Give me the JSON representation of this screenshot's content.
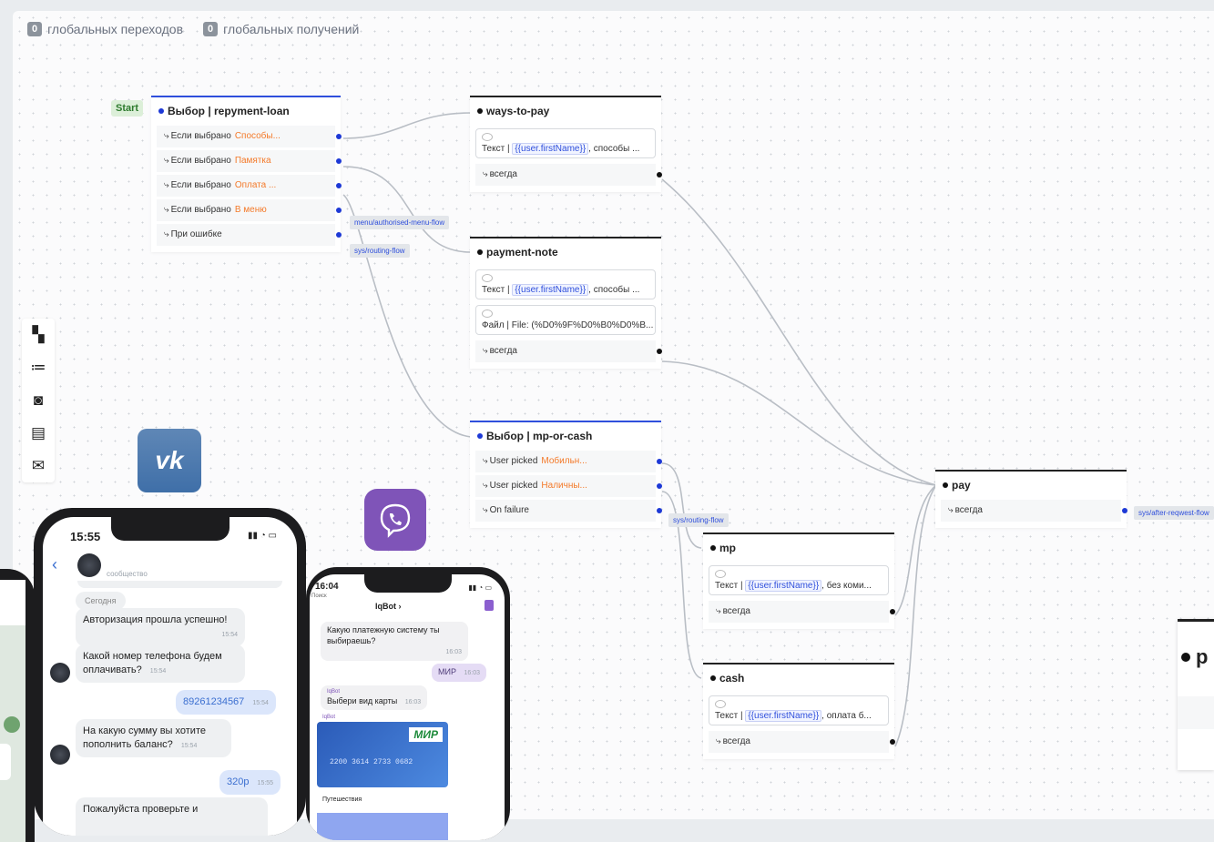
{
  "counters": [
    {
      "count": "0",
      "label": "глобальных переходов"
    },
    {
      "count": "0",
      "label": "глобальных получений"
    }
  ],
  "start_label": "Start",
  "nodes": {
    "repayment": {
      "title": "Выбор | repyment-loan",
      "rows": [
        {
          "label": "Если выбрано",
          "value": "Способы..."
        },
        {
          "label": "Если выбрано",
          "value": "Памятка"
        },
        {
          "label": "Если выбрано",
          "value": "Оплата ..."
        },
        {
          "label": "Если выбрано",
          "value": "В меню"
        },
        {
          "label": "При ошибке",
          "value": ""
        }
      ]
    },
    "ways": {
      "title": "ways-to-pay",
      "msg_prefix": "Текст |",
      "msg_var": "{{user.firstName}}",
      "msg_tail": ", способы ...",
      "always": "всегда"
    },
    "note": {
      "title": "payment-note",
      "msg_prefix": "Текст |",
      "msg_var": "{{user.firstName}}",
      "msg_tail": ", способы ...",
      "file": "Файл | File: (%D0%9F%D0%B0%D0%B...",
      "always": "всегда"
    },
    "mpcash": {
      "title": "Выбор | mp-or-cash",
      "rows": [
        {
          "label": "User picked",
          "value": "Мобильн..."
        },
        {
          "label": "User picked",
          "value": "Наличны..."
        },
        {
          "label": "On failure",
          "value": ""
        }
      ]
    },
    "pay": {
      "title": "pay",
      "always": "всегда"
    },
    "mp": {
      "title": "mp",
      "msg_prefix": "Текст |",
      "msg_var": "{{user.firstName}}",
      "msg_tail": ", без коми...",
      "always": "всегда"
    },
    "cash": {
      "title": "cash",
      "msg_prefix": "Текст |",
      "msg_var": "{{user.firstName}}",
      "msg_tail": ", оплата б...",
      "always": "всегда"
    }
  },
  "flow_tags": {
    "menu": "menu/authorised-menu-flow",
    "routing1": "sys/routing-flow",
    "routing2": "sys/routing-flow",
    "after": "sys/after-reqwest-flow"
  },
  "tools": [
    {
      "icon": "comment-icon",
      "glyph": "▚"
    },
    {
      "icon": "numbered-list-icon",
      "glyph": "≔"
    },
    {
      "icon": "camera-icon",
      "glyph": "◙"
    },
    {
      "icon": "split-icon",
      "glyph": "▤"
    },
    {
      "icon": "mail-icon",
      "glyph": "✉"
    }
  ],
  "vk_logo": "vk",
  "phone_vk": {
    "time": "15:55",
    "header_sub": "сообщество",
    "date": "Сегодня",
    "messages": [
      {
        "text": "Авторизация прошла успешно!",
        "time": "15:54",
        "out": false
      },
      {
        "text": "Какой номер телефона будем оплачивать?",
        "time": "15:54",
        "out": false
      },
      {
        "text": "89261234567",
        "time": "15:54",
        "out": true
      },
      {
        "text": "На какую сумму вы хотите пополнить баланс?",
        "time": "15:54",
        "out": false
      },
      {
        "text": "320р",
        "time": "15:55",
        "out": true
      },
      {
        "text": "Пожалуйста проверьте и",
        "time": "",
        "out": false
      }
    ]
  },
  "phone_viber": {
    "time": "16:04",
    "search": "Поиск",
    "bot_name": "IqBot ›",
    "sender": "IqBot",
    "messages": [
      {
        "text": "Какую платежную систему ты выбираешь?",
        "time": "16:03"
      },
      {
        "text": "МИР",
        "time": "16:03"
      },
      {
        "text": "Выбери вид карты",
        "time": "16:03"
      }
    ],
    "card_brand": "МИР",
    "card_number": "2200 3614 2733 0682",
    "card_caption": "Путешествия"
  },
  "partial_node_letter": "р"
}
